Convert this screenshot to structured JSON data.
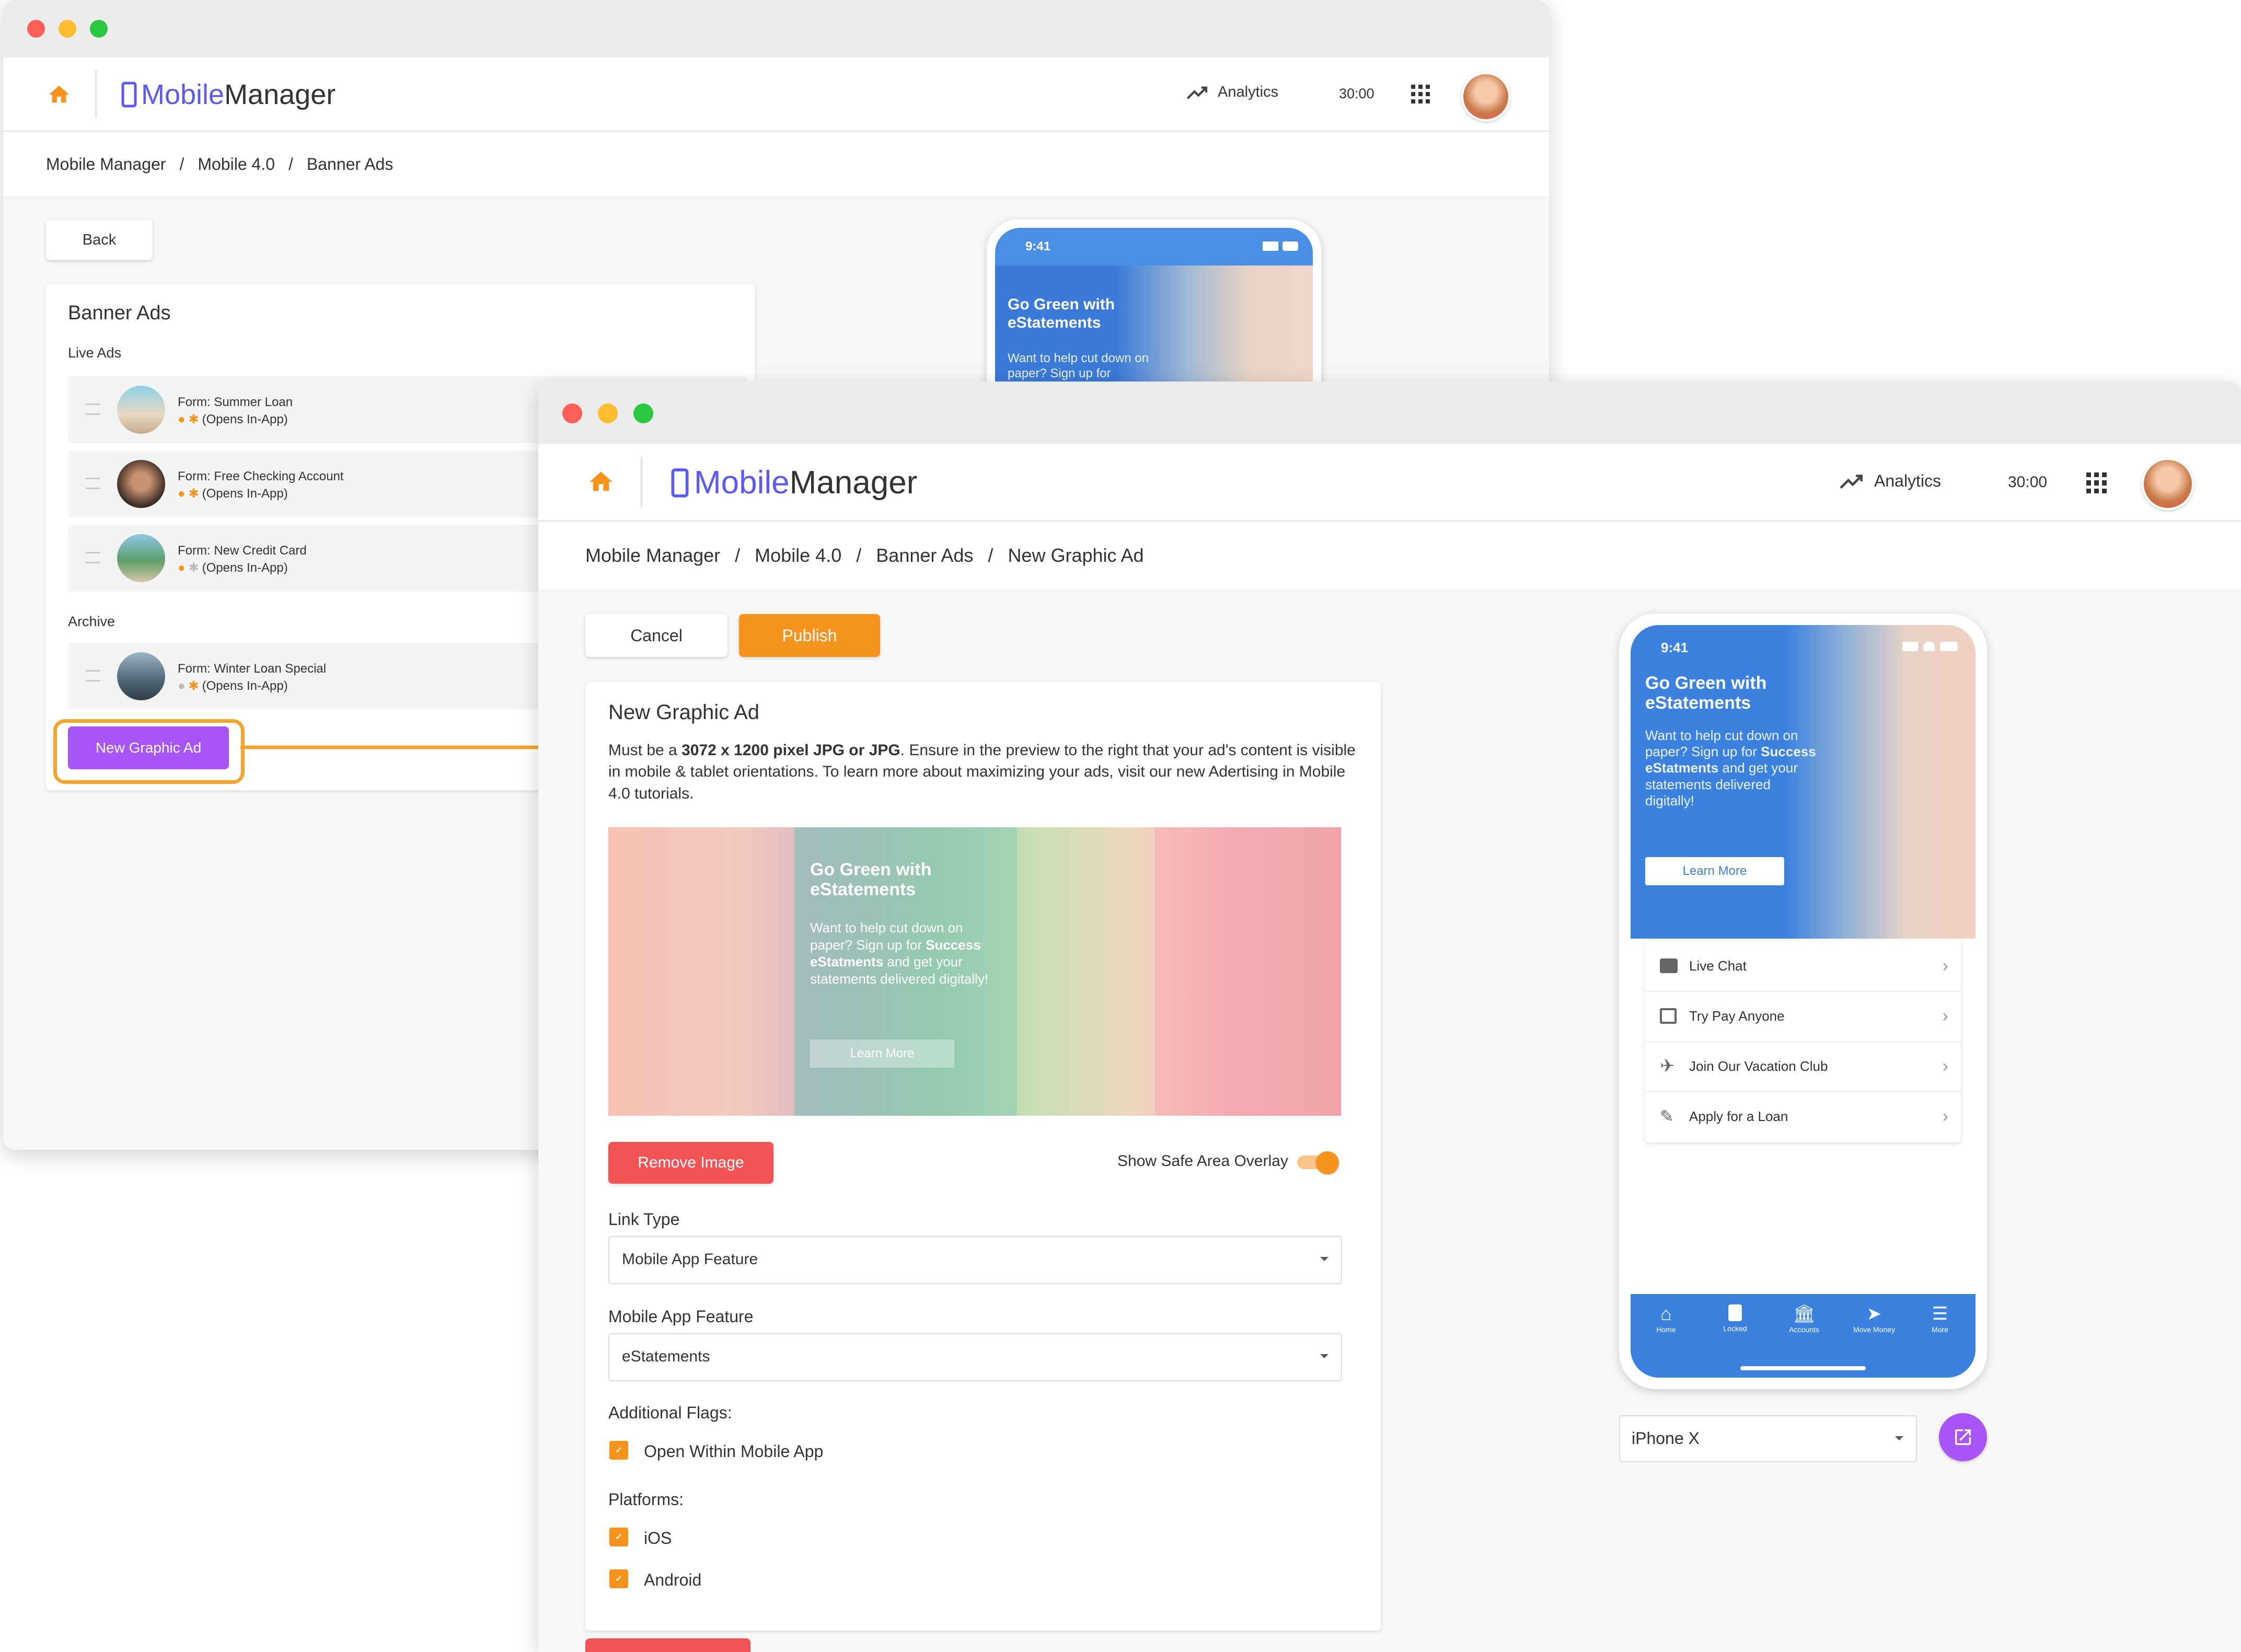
{
  "back_window": {
    "brand": {
      "mobile": "Mobile",
      "manager": "Manager"
    },
    "header": {
      "analytics": "Analytics",
      "timer": "30:00"
    },
    "breadcrumb": [
      "Mobile Manager",
      "/",
      "Mobile 4.0",
      "/",
      "Banner Ads"
    ],
    "back_label": "Back",
    "panel_title": "Banner Ads",
    "live_ads_label": "Live Ads",
    "live_ads": [
      {
        "title": "Form: Summer Loan",
        "sub": "(Opens In-App)"
      },
      {
        "title": "Form: Free Checking Account",
        "sub": "(Opens In-App)"
      },
      {
        "title": "Form: New Credit Card",
        "sub": "(Opens In-App)"
      }
    ],
    "archive_label": "Archive",
    "archive_ads": [
      {
        "title": "Form: Winter Loan Special",
        "sub": "(Opens In-App)"
      }
    ],
    "new_ad_label": "New Graphic Ad",
    "phone": {
      "time": "9:41",
      "headline": "Go Green with eStatements",
      "body": "Want to help cut down on paper? Sign up for"
    }
  },
  "front_window": {
    "brand": {
      "mobile": "Mobile",
      "manager": "Manager"
    },
    "header": {
      "analytics": "Analytics",
      "timer": "30:00"
    },
    "breadcrumb": [
      "Mobile Manager",
      "/",
      "Mobile 4.0",
      "/",
      "Banner Ads",
      "/",
      "New Graphic Ad"
    ],
    "cancel_label": "Cancel",
    "publish_label": "Publish",
    "form_title": "New Graphic Ad",
    "description": {
      "pre": "Must be a ",
      "bold": "3072 x 1200 pixel JPG or JPG",
      "post": ". Ensure in the preview to the right that your ad's content is visible in mobile & tablet orientations. To learn more about maximizing your ads, visit our new Adertising in Mobile 4.0 tutorials."
    },
    "banner": {
      "headline": "Go Green with eStatements",
      "body_pre": "Want to help cut down on paper? Sign up for ",
      "body_bold": "Success eStatments",
      "body_post": " and get your statements delivered digitally!",
      "cta": "Learn More"
    },
    "remove_image_label": "Remove Image",
    "safe_area_label": "Show Safe Area Overlay",
    "link_type_label": "Link Type",
    "link_type_value": "Mobile App Feature",
    "feature_label": "Mobile App Feature",
    "feature_value": "eStatements",
    "flags_label": "Additional Flags:",
    "flags": [
      "Open Within Mobile App"
    ],
    "platforms_label": "Platforms:",
    "platforms": [
      "iOS",
      "Android"
    ],
    "phone": {
      "time": "9:41",
      "headline": "Go Green with eStatements",
      "body_pre": "Want to help cut down on paper? Sign up for ",
      "body_bold": "Success eStatments",
      "body_post": " and get your statements delivered digitally!",
      "cta": "Learn More",
      "menu": [
        "Live Chat",
        "Try Pay Anyone",
        "Join Our Vacation Club",
        "Apply for a Loan"
      ],
      "tabs": [
        "Home",
        "Locked",
        "Accounts",
        "Move Money",
        "More"
      ]
    },
    "device_value": "iPhone X"
  },
  "colors": {
    "accent": "#f7941d",
    "brand": "#5b5bf0",
    "purple": "#a855f7",
    "danger": "#f05454",
    "phone_blue": "#3b82e0"
  }
}
